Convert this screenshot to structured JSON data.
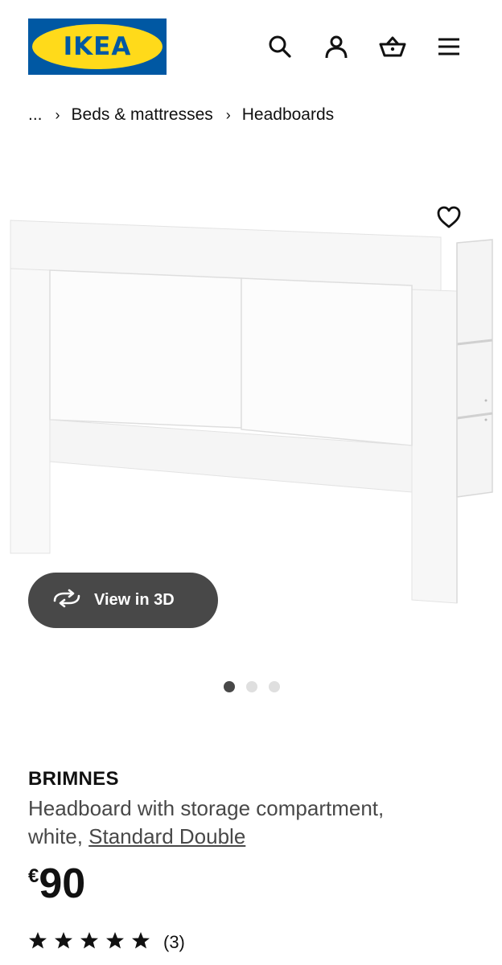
{
  "header": {
    "logo_text": "IKEA",
    "logo_mark": "®",
    "icons": [
      "search-icon",
      "user-icon",
      "basket-icon",
      "menu-icon"
    ]
  },
  "breadcrumb": {
    "ellipsis": "...",
    "separator": "›",
    "items": [
      "Beds & mattresses",
      "Headboards"
    ]
  },
  "media": {
    "favourite_icon": "heart-icon",
    "view3d_label": "View in 3D",
    "view3d_icon": "rotate-icon",
    "carousel_pages": 3,
    "carousel_active": 1
  },
  "product": {
    "name": "BRIMNES",
    "description": "Headboard with storage compartment,",
    "variant_prefix": "white,",
    "size_link": "Standard Double",
    "currency": "€",
    "price": "90",
    "rating_stars": 5,
    "rating_count": "(3)"
  },
  "colors": {
    "logo_blue": "#0058a3",
    "logo_yellow": "#ffda1a",
    "button_bg": "#484848",
    "text": "#111111"
  }
}
